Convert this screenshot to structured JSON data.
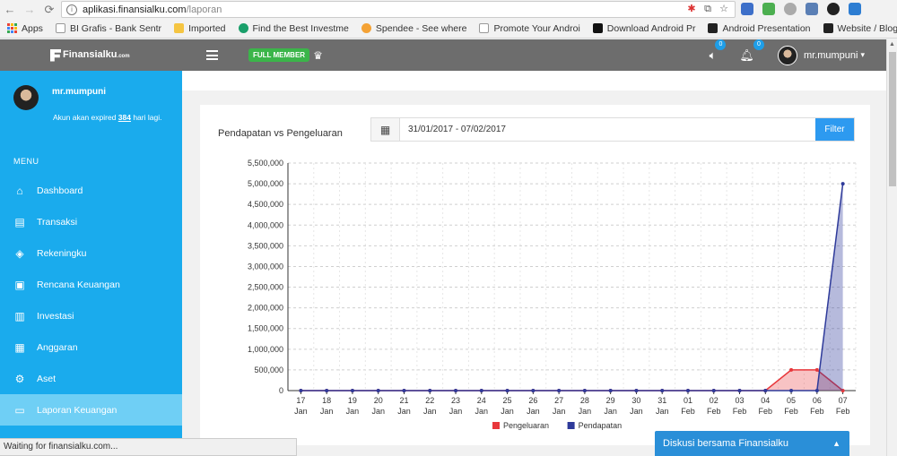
{
  "browser": {
    "url_host": "aplikasi.finansialku.com",
    "url_path": "/laporan",
    "bookmarks": [
      {
        "label": "Apps",
        "color": "#ea4335"
      },
      {
        "label": "BI Grafis - Bank Sentr",
        "color": "#ffffff"
      },
      {
        "label": "Imported",
        "color": "#f5c542"
      },
      {
        "label": "Find the Best Investme",
        "color": "#1a9f6a"
      },
      {
        "label": "Spendee - See where",
        "color": "#f4a235"
      },
      {
        "label": "Promote Your Androi",
        "color": "#ffffff"
      },
      {
        "label": "Download Android Pr",
        "color": "#111111"
      },
      {
        "label": "Android Presentation",
        "color": "#222222"
      },
      {
        "label": "Website / Blog / E-cor",
        "color": "#222222"
      }
    ]
  },
  "header": {
    "brand": "Finansialku",
    "brand_suffix": ".com",
    "member_badge": "FULL MEMBER",
    "sound_count": "0",
    "notif_count": "0",
    "username": "mr.mumpuni"
  },
  "sidebar": {
    "name": "mr.mumpuni",
    "expiry_prefix": "Akun akan expired ",
    "expiry_days": "384",
    "expiry_suffix": " hari lagi.",
    "menu_label": "MENU",
    "items": [
      {
        "label": "Dashboard",
        "icon": "dashboard-icon",
        "glyph": "⌂",
        "active": false
      },
      {
        "label": "Transaksi",
        "icon": "transaksi-icon",
        "glyph": "▤",
        "active": false
      },
      {
        "label": "Rekeningku",
        "icon": "layers-icon",
        "glyph": "◈",
        "active": false
      },
      {
        "label": "Rencana Keuangan",
        "icon": "clipboard-icon",
        "glyph": "▣",
        "active": false
      },
      {
        "label": "Investasi",
        "icon": "chart-icon",
        "glyph": "▥",
        "active": false
      },
      {
        "label": "Anggaran",
        "icon": "calculator-icon",
        "glyph": "▦",
        "active": false
      },
      {
        "label": "Aset",
        "icon": "asset-icon",
        "glyph": "⚙",
        "active": false
      },
      {
        "label": "Laporan Keuangan",
        "icon": "folder-icon",
        "glyph": "▭",
        "active": true
      }
    ]
  },
  "card": {
    "title": "Pendapatan vs Pengeluaran",
    "date_range": "31/01/2017 - 07/02/2017",
    "filter_label": "Filter"
  },
  "chart_data": {
    "type": "area",
    "x": [
      [
        "17",
        "Jan"
      ],
      [
        "18",
        "Jan"
      ],
      [
        "19",
        "Jan"
      ],
      [
        "20",
        "Jan"
      ],
      [
        "21",
        "Jan"
      ],
      [
        "22",
        "Jan"
      ],
      [
        "23",
        "Jan"
      ],
      [
        "24",
        "Jan"
      ],
      [
        "25",
        "Jan"
      ],
      [
        "26",
        "Jan"
      ],
      [
        "27",
        "Jan"
      ],
      [
        "28",
        "Jan"
      ],
      [
        "29",
        "Jan"
      ],
      [
        "30",
        "Jan"
      ],
      [
        "31",
        "Jan"
      ],
      [
        "01",
        "Feb"
      ],
      [
        "02",
        "Feb"
      ],
      [
        "03",
        "Feb"
      ],
      [
        "04",
        "Feb"
      ],
      [
        "05",
        "Feb"
      ],
      [
        "06",
        "Feb"
      ],
      [
        "07",
        "Feb"
      ]
    ],
    "series": [
      {
        "name": "Pengeluaran",
        "color": "#e8373b",
        "values": [
          0,
          0,
          0,
          0,
          0,
          0,
          0,
          0,
          0,
          0,
          0,
          0,
          0,
          0,
          0,
          0,
          0,
          0,
          0,
          500000,
          500000,
          0
        ]
      },
      {
        "name": "Pendapatan",
        "color": "#2e3a9a",
        "values": [
          0,
          0,
          0,
          0,
          0,
          0,
          0,
          0,
          0,
          0,
          0,
          0,
          0,
          0,
          0,
          0,
          0,
          0,
          0,
          0,
          0,
          5000000
        ]
      }
    ],
    "yticks": [
      "0",
      "500,000",
      "1,000,000",
      "1,500,000",
      "2,000,000",
      "2,500,000",
      "3,000,000",
      "3,500,000",
      "4,000,000",
      "4,500,000",
      "5,000,000",
      "5,500,000"
    ],
    "ylim": [
      0,
      5500000
    ],
    "grid": true,
    "legend": "bottom"
  },
  "status_text": "Waiting for finansialku.com...",
  "chat_label": "Diskusi bersama Finansialku"
}
